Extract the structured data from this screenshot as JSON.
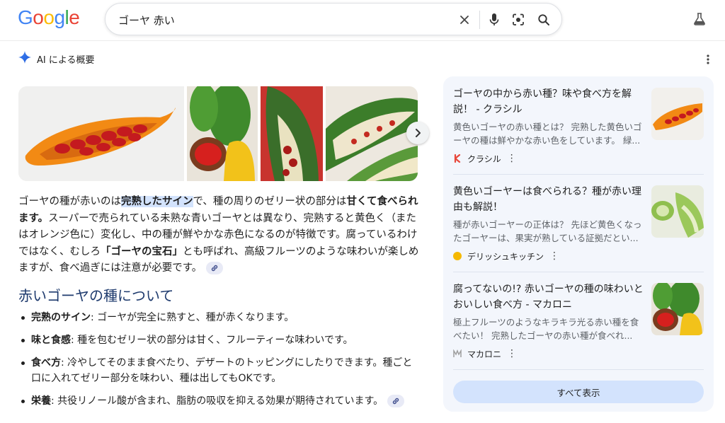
{
  "header": {
    "logo_letters": [
      "G",
      "o",
      "o",
      "g",
      "l",
      "e"
    ],
    "logo_colors": [
      "#4285F4",
      "#EA4335",
      "#FBBC05",
      "#4285F4",
      "#34A853",
      "#EA4335"
    ],
    "search_query": "ゴーヤ 赤い",
    "icons": [
      "clear-icon",
      "mic-icon",
      "lens-icon",
      "search-icon",
      "labs-flask-icon"
    ]
  },
  "ai_overview": {
    "label": "AI による概要",
    "paragraph": {
      "p1": "ゴーヤの種が赤いのは",
      "hl1": "完熟したサイン",
      "p2": "で、種の周りのゼリー状の部分は",
      "b1": "甘くて食べられます。",
      "p3": "スーパーで売られている未熟な青いゴーヤとは異なり、完熟すると黄色く（またはオレンジ色に）変化し、中の種が鮮やかな赤色になるのが特徴です。腐っているわけではなく、むしろ",
      "b2": "「ゴーヤの宝石」",
      "p4": "とも呼ばれ、高級フルーツのような味わいが楽しめますが、食べ過ぎには注意が必要です。"
    },
    "section_title": "赤いゴーヤの種について",
    "bullets": [
      {
        "term": "完熟のサイン",
        "text": ": ゴーヤが完全に熟すと、種が赤くなります。"
      },
      {
        "term": "味と食感",
        "text": ": 種を包むゼリー状の部分は甘く、フルーティーな味わいです。"
      },
      {
        "term": "食べ方",
        "text": ": 冷やしてそのまま食べたり、デザートのトッピングにしたりできます。種ごと口に入れてゼリー部分を味わい、種は出してもOKです。"
      },
      {
        "term": "栄養",
        "text": ": 共役リノール酸が含まれ、脂肪の吸収を抑える効果が期待されています。"
      }
    ]
  },
  "sources": [
    {
      "title": "ゴーヤの中から赤い種？味や食べ方を解説！ - クラシル",
      "snippet": "黄色いゴーヤの赤い種とは？ 完熟した黄色いゴーヤの種は鮮やかな赤い色をしています。 緑...",
      "site": "クラシル",
      "favicon_color": "#e8473b"
    },
    {
      "title": "黄色いゴーヤーは食べられる？種が赤い理由も解説！",
      "snippet": "種が赤いゴーヤーの正体は？ 先ほど黄色くなったゴーヤーは、果実が熟している証拠だとい...",
      "site": "デリッシュキッチン",
      "favicon_color": "#f5b800"
    },
    {
      "title": "腐ってないの!? 赤いゴーヤの種の味わいとおいしい食べ方 - マカロニ",
      "snippet": "極上フルーツのようなキラキラ光る赤い種を食べたい！ 完熟したゴーヤの赤い種が食べれ...",
      "site": "マカロニ",
      "favicon_color": "#9e9e9e"
    }
  ],
  "show_all_label": "すべて表示"
}
